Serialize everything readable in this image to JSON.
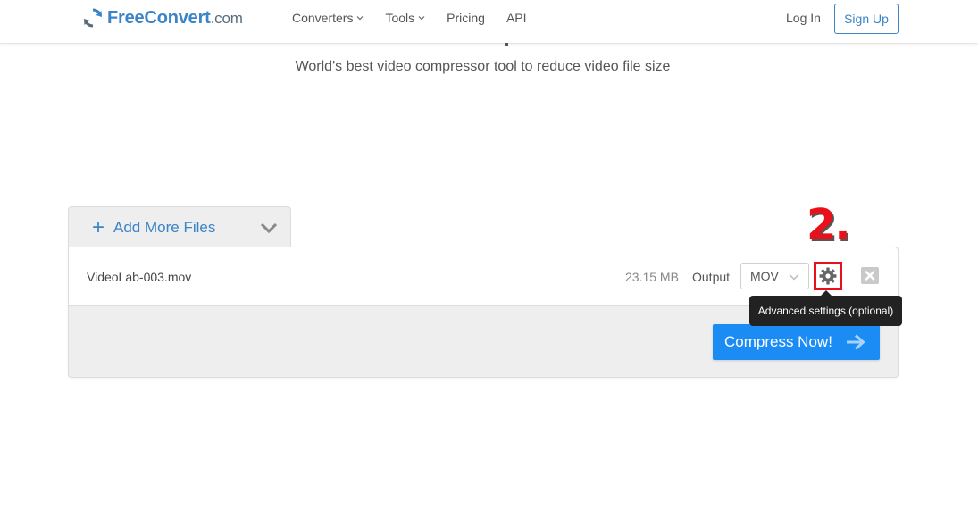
{
  "header": {
    "logo": {
      "brand": "FreeConvert",
      "suffix": ".com",
      "icon": "refresh-arrows-icon",
      "color": "#3b84c6"
    },
    "nav": [
      {
        "label": "Converters",
        "has_dropdown": true
      },
      {
        "label": "Tools",
        "has_dropdown": true
      },
      {
        "label": "Pricing",
        "has_dropdown": false
      },
      {
        "label": "API",
        "has_dropdown": false
      }
    ],
    "login_label": "Log In",
    "signup_label": "Sign Up"
  },
  "hero": {
    "subtitle": "World's best video compressor tool to reduce video file size"
  },
  "uploader": {
    "add_files_label": "Add More Files",
    "file": {
      "name": "VideoLab-003.mov",
      "size": "23.15 MB",
      "output_label": "Output",
      "output_format": "MOV"
    },
    "compress_label": "Compress Now!"
  },
  "annotation": {
    "step": "2.",
    "tooltip": "Advanced settings (optional)",
    "highlight_color": "#e8101a"
  },
  "colors": {
    "primary": "#1c8cf5",
    "brand": "#3b84c6",
    "panel_bg": "#eeeeee"
  }
}
